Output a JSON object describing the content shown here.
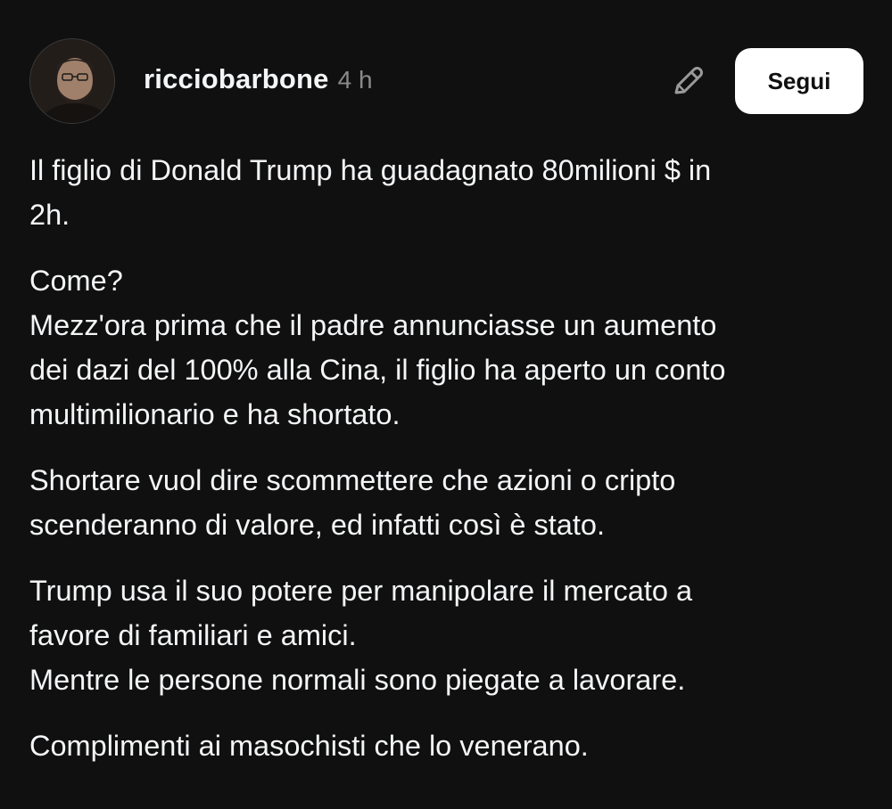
{
  "post": {
    "author": {
      "username": "ricciobarbone",
      "avatar_icon": "user-avatar-photo"
    },
    "timestamp": "4 h",
    "edit_icon": "pencil-icon",
    "follow_label": "Segui",
    "paragraphs": [
      [
        "Il figlio di Donald Trump ha guadagnato 80milioni $ in",
        "2h."
      ],
      [
        "Come?",
        "Mezz'ora prima che il padre annunciasse un aumento",
        "dei dazi del 100% alla Cina, il figlio ha aperto un conto",
        "multimilionario e ha shortato."
      ],
      [
        "Shortare vuol dire scommettere che azioni o cripto",
        "scenderanno di valore, ed infatti così è stato."
      ],
      [
        "Trump usa il suo potere per manipolare il mercato a",
        "favore di familiari e amici.",
        "Mentre le persone normali sono piegate a lavorare."
      ],
      [
        "Complimenti ai masochisti che lo venerano."
      ]
    ]
  },
  "colors": {
    "background": "#101010",
    "text": "#f3f5f7",
    "muted": "#8a8a8a",
    "button_bg": "#ffffff",
    "button_text": "#101010"
  }
}
